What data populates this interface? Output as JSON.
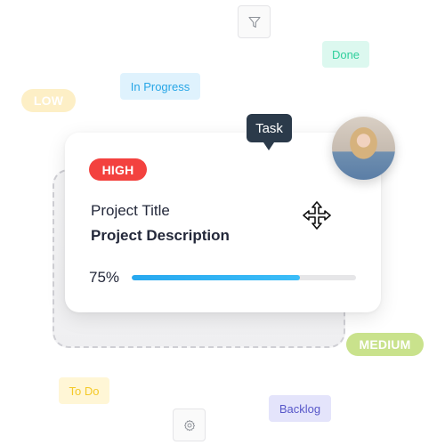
{
  "toolbar": {
    "filter_icon": "filter-icon",
    "settings_icon": "gear-icon"
  },
  "status_tags": {
    "done": "Done",
    "in_progress": "In Progress",
    "todo": "To Do",
    "backlog": "Backlog"
  },
  "priority_pills": {
    "low": "LOW",
    "medium": "MEDIUM",
    "high": "HIGH"
  },
  "tooltip": {
    "label": "Task"
  },
  "task_card": {
    "priority": "HIGH",
    "title": "Project Title",
    "description": "Project Description",
    "progress_label": "75%",
    "progress_value": 0.75,
    "move_icon": "move-cursor-icon",
    "assignee_avatar": "avatar"
  },
  "colors": {
    "high": "#f3423f",
    "medium": "#c9e28c",
    "low": "#fdefc6",
    "progress": "#27a8ef",
    "tooltip_bg": "#2b3a4a",
    "done": "#2fcf9c",
    "in_progress": "#27a6e6",
    "todo": "#f4c928",
    "backlog": "#5757c9"
  }
}
